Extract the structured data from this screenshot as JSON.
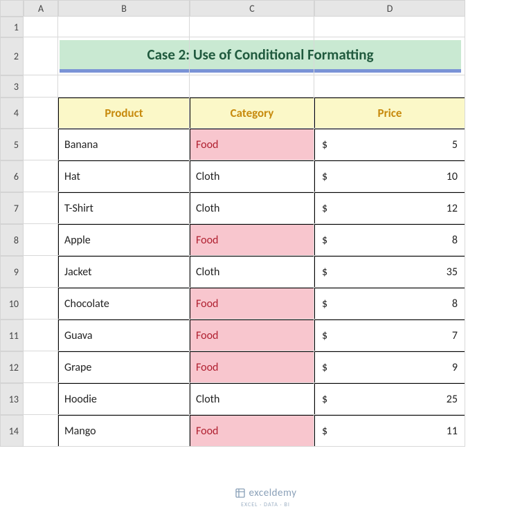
{
  "columns": [
    "A",
    "B",
    "C",
    "D"
  ],
  "rows": [
    "1",
    "2",
    "3",
    "4",
    "5",
    "6",
    "7",
    "8",
    "9",
    "10",
    "11",
    "12",
    "13",
    "14"
  ],
  "title": "Case 2: Use of Conditional Formatting",
  "headers": {
    "product": "Product",
    "category": "Category",
    "price": "Price"
  },
  "currency": "$",
  "highlight_value": "Food",
  "chart_data": {
    "type": "table",
    "columns": [
      "Product",
      "Category",
      "Price"
    ],
    "rows": [
      {
        "product": "Banana",
        "category": "Food",
        "price": 5,
        "highlight": true
      },
      {
        "product": "Hat",
        "category": "Cloth",
        "price": 10,
        "highlight": false
      },
      {
        "product": "T-Shirt",
        "category": "Cloth",
        "price": 12,
        "highlight": false
      },
      {
        "product": "Apple",
        "category": "Food",
        "price": 8,
        "highlight": true
      },
      {
        "product": "Jacket",
        "category": "Cloth",
        "price": 35,
        "highlight": false
      },
      {
        "product": "Chocolate",
        "category": "Food",
        "price": 8,
        "highlight": true
      },
      {
        "product": "Guava",
        "category": "Food",
        "price": 7,
        "highlight": true
      },
      {
        "product": "Grape",
        "category": "Food",
        "price": 9,
        "highlight": true
      },
      {
        "product": "Hoodie",
        "category": "Cloth",
        "price": 25,
        "highlight": false
      },
      {
        "product": "Mango",
        "category": "Food",
        "price": 11,
        "highlight": true
      }
    ]
  },
  "watermark": {
    "brand": "exceldemy",
    "tagline": "EXCEL · DATA · BI"
  }
}
